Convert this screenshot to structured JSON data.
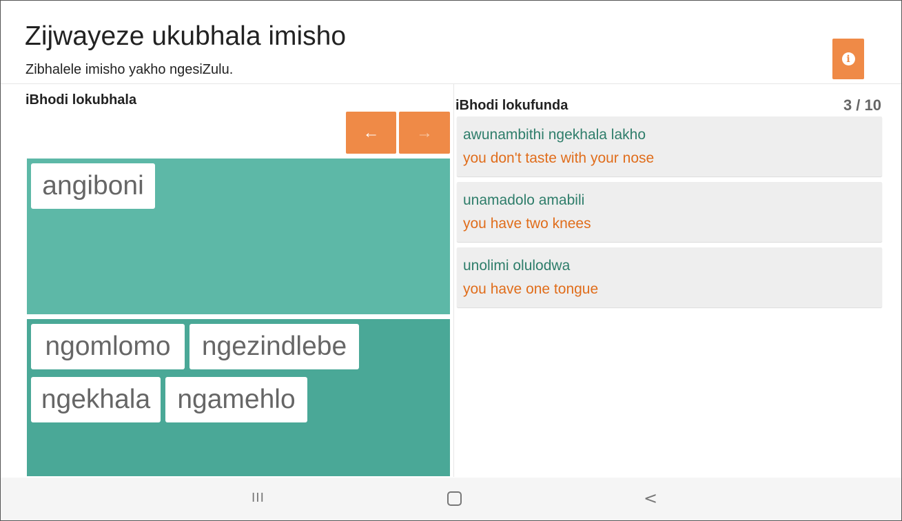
{
  "header": {
    "title": "Zijwayeze ukubhala imisho",
    "subtitle": "Zibhalele imisho yakho ngesiZulu.",
    "info_icon": "info-icon",
    "info_glyph": "i"
  },
  "colors": {
    "accent": "#ef8a47",
    "answer_area": "#5db8a7",
    "word_bank": "#4aa897",
    "zulu_text": "#2e7d6a",
    "english_text": "#e06d1b"
  },
  "writing_board": {
    "title": "iBhodi lokubhala",
    "back_glyph": "←",
    "forward_glyph": "→",
    "answer_tiles": [
      "angiboni"
    ],
    "bank_tiles": [
      "ngomlomo",
      "ngezindlebe",
      "ngekhala",
      "ngamehlo"
    ]
  },
  "learning_board": {
    "title": "iBhodi lokufunda",
    "progress": "3 / 10",
    "cards": [
      {
        "zulu": "awunambithi ngekhala lakho",
        "english": "you don't taste with your nose"
      },
      {
        "zulu": "unamadolo amabili",
        "english": "you have two knees"
      },
      {
        "zulu": "unolimi olulodwa",
        "english": "you have one tongue"
      }
    ]
  },
  "system_nav": {
    "recents_glyph": "III",
    "back_glyph": "<"
  }
}
